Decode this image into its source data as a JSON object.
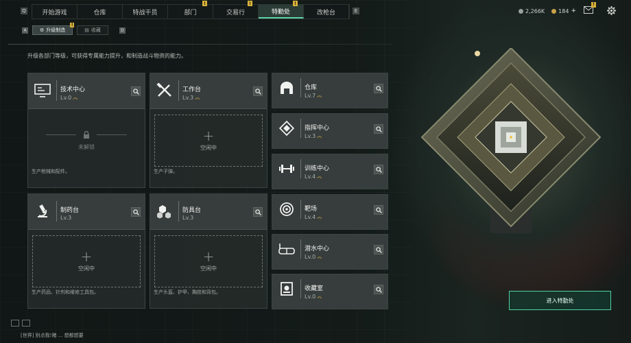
{
  "nav": {
    "left_key": "Q",
    "right_key": "E",
    "tabs": [
      {
        "label": "开始游戏",
        "active": false,
        "badge": ""
      },
      {
        "label": "仓库",
        "active": false,
        "badge": ""
      },
      {
        "label": "特战干员",
        "active": false,
        "badge": ""
      },
      {
        "label": "部门",
        "active": false,
        "badge": "!"
      },
      {
        "label": "交易行",
        "active": false,
        "badge": "!"
      },
      {
        "label": "特勤处",
        "active": true,
        "badge": "!"
      },
      {
        "label": "改枪台",
        "active": false,
        "badge": ""
      }
    ]
  },
  "resources": {
    "silver": "2,266K",
    "gold": "184",
    "plus": "+"
  },
  "top_icons": [
    "mail-icon",
    "gear-icon"
  ],
  "top_badge": "!",
  "subtabs": {
    "left_key": "A",
    "right_key": "D",
    "items": [
      {
        "label": "升级制造",
        "active": true,
        "badge": "!"
      },
      {
        "label": "收藏",
        "active": false,
        "badge": ""
      }
    ]
  },
  "description": "升级各部门等级，可获得专属能力提升，和制造战斗物资的能力。",
  "facilities_large": [
    {
      "name": "技术中心",
      "level": "Lv.0",
      "icon": "monitor-icon",
      "slot": "locked",
      "slot_text": "未解锁",
      "footnote": "生产枪械和配件。"
    },
    {
      "name": "工作台",
      "level": "Lv.3",
      "icon": "tools-icon",
      "slot": "idle",
      "slot_text": "空闲中",
      "footnote": "生产子弹。"
    },
    {
      "name": "制药台",
      "level": "Lv.3",
      "icon": "microscope-icon",
      "slot": "idle",
      "slot_text": "空闲中",
      "footnote": "生产药品、针剂和维修工具包。"
    },
    {
      "name": "防具台",
      "level": "Lv.3",
      "icon": "armor-icon",
      "slot": "idle",
      "slot_text": "空闲中",
      "footnote": "生产头盔、护甲、胸挂和背包。"
    }
  ],
  "facilities_small": [
    {
      "name": "仓库",
      "level": "Lv.7",
      "icon": "warehouse-icon"
    },
    {
      "name": "指挥中心",
      "level": "Lv.3",
      "icon": "command-icon"
    },
    {
      "name": "训练中心",
      "level": "Lv.4",
      "icon": "dumbbell-icon"
    },
    {
      "name": "靶场",
      "level": "Lv.4",
      "icon": "target-icon"
    },
    {
      "name": "潜水中心",
      "level": "Lv.0",
      "icon": "diving-mask-icon"
    },
    {
      "name": "收藏室",
      "level": "Lv.0",
      "icon": "collection-icon"
    }
  ],
  "enter_button": "进入特勤处",
  "chat": "[世界] 别点我!赌 ... 想都想要"
}
